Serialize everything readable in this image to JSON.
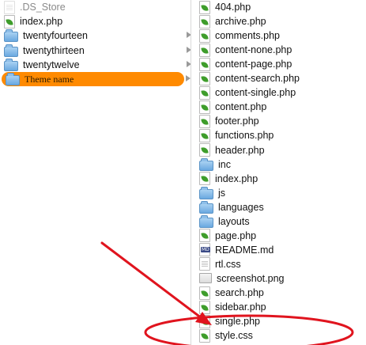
{
  "finder": {
    "left_column": {
      "items": [
        {
          "label": ".DS_Store",
          "icon": "file-icon",
          "kind": "hidden"
        },
        {
          "label": "index.php",
          "icon": "php-file-icon"
        },
        {
          "label": "twentyfourteen",
          "icon": "folder-icon",
          "has_children": true
        },
        {
          "label": "twentythirteen",
          "icon": "folder-icon",
          "has_children": true
        },
        {
          "label": "twentytwelve",
          "icon": "folder-icon",
          "has_children": true
        },
        {
          "label": "Theme name",
          "icon": "folder-icon",
          "has_children": true,
          "selected": true
        }
      ]
    },
    "right_column": {
      "items": [
        {
          "label": "404.php",
          "icon": "php-file-icon"
        },
        {
          "label": "archive.php",
          "icon": "php-file-icon"
        },
        {
          "label": "comments.php",
          "icon": "php-file-icon"
        },
        {
          "label": "content-none.php",
          "icon": "php-file-icon"
        },
        {
          "label": "content-page.php",
          "icon": "php-file-icon"
        },
        {
          "label": "content-search.php",
          "icon": "php-file-icon"
        },
        {
          "label": "content-single.php",
          "icon": "php-file-icon"
        },
        {
          "label": "content.php",
          "icon": "php-file-icon"
        },
        {
          "label": "footer.php",
          "icon": "php-file-icon"
        },
        {
          "label": "functions.php",
          "icon": "php-file-icon"
        },
        {
          "label": "header.php",
          "icon": "php-file-icon"
        },
        {
          "label": "inc",
          "icon": "folder-icon"
        },
        {
          "label": "index.php",
          "icon": "php-file-icon"
        },
        {
          "label": "js",
          "icon": "folder-icon"
        },
        {
          "label": "languages",
          "icon": "folder-icon"
        },
        {
          "label": "layouts",
          "icon": "folder-icon"
        },
        {
          "label": "page.php",
          "icon": "php-file-icon"
        },
        {
          "label": "README.md",
          "icon": "markdown-file-icon"
        },
        {
          "label": "rtl.css",
          "icon": "text-file-icon"
        },
        {
          "label": "screenshot.png",
          "icon": "image-file-icon"
        },
        {
          "label": "search.php",
          "icon": "php-file-icon"
        },
        {
          "label": "sidebar.php",
          "icon": "php-file-icon"
        },
        {
          "label": "single.php",
          "icon": "php-file-icon"
        },
        {
          "label": "style.css",
          "icon": "css-file-icon",
          "highlighted": true
        }
      ]
    }
  },
  "annotation": {
    "color": "#e0141e",
    "arrow_icon": "red-arrow-annotation",
    "highlight_icon": "red-ellipse-annotation"
  },
  "colors": {
    "selection": "#ff8a00",
    "folder": "#6aa8e0",
    "php_leaf": "#3e9d2b"
  }
}
